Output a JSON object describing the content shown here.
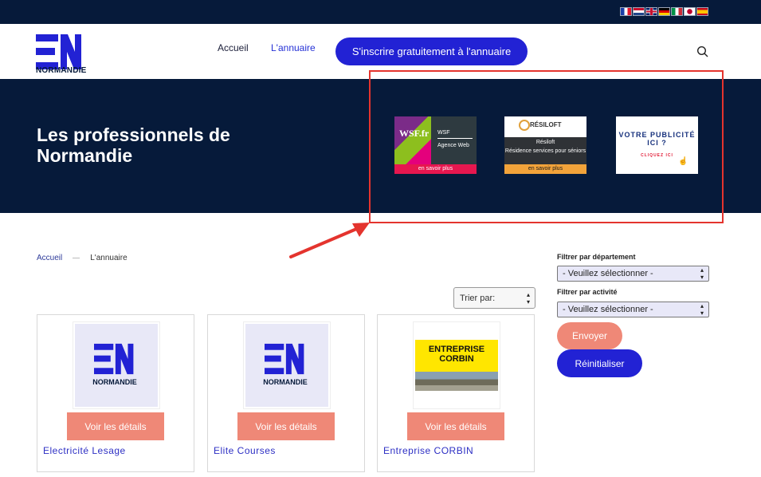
{
  "flags": [
    "france-flag-icon",
    "netherlands-flag-icon",
    "uk-flag-icon",
    "germany-flag-icon",
    "italy-flag-icon",
    "japan-flag-icon",
    "spain-flag-icon"
  ],
  "header": {
    "logo_text": "NORMANDIE",
    "nav": {
      "home": "Accueil",
      "annuaire": "L'annuaire"
    },
    "cta": "S'inscrire gratuitement à l'annuaire",
    "search_icon": "search-icon"
  },
  "hero": {
    "title": "Les professionnels de Normandie",
    "ads": {
      "wsf": {
        "brand": "WSF.fr",
        "name": "WSF",
        "desc": "Agence Web",
        "more": "en savoir plus"
      },
      "resiloft": {
        "brand": "RÉSILOFT",
        "name": "Résiloft",
        "desc": "Résidence services pour séniors",
        "more": "en savoir plus"
      },
      "pub": {
        "title": "VOTRE PUBLICITÉ ICI ?",
        "cta": "CLIQUEZ ICI"
      }
    }
  },
  "breadcrumb": {
    "home": "Accueil",
    "current": "L'annuaire"
  },
  "sort": {
    "label": "Trier par:"
  },
  "cards": [
    {
      "logo_text": "NORMANDIE",
      "button": "Voir les détails",
      "name": "Electricité Lesage"
    },
    {
      "logo_text": "NORMANDIE",
      "button": "Voir les détails",
      "name": "Elite Courses"
    },
    {
      "logo_text": "ENTREPRISE CORBIN",
      "button": "Voir les détails",
      "name": "Entreprise CORBIN"
    }
  ],
  "filters": {
    "dept_label": "Filtrer par département",
    "dept_value": "- Veuillez sélectionner -",
    "activity_label": "Filtrer par activité",
    "activity_value": "- Veuillez sélectionner -",
    "send": "Envoyer",
    "reset": "Réinitialiser"
  },
  "colors": {
    "navy": "#061a3a",
    "brand_blue": "#2222d4",
    "salmon": "#ef8877",
    "annotation_red": "#e4342e"
  }
}
